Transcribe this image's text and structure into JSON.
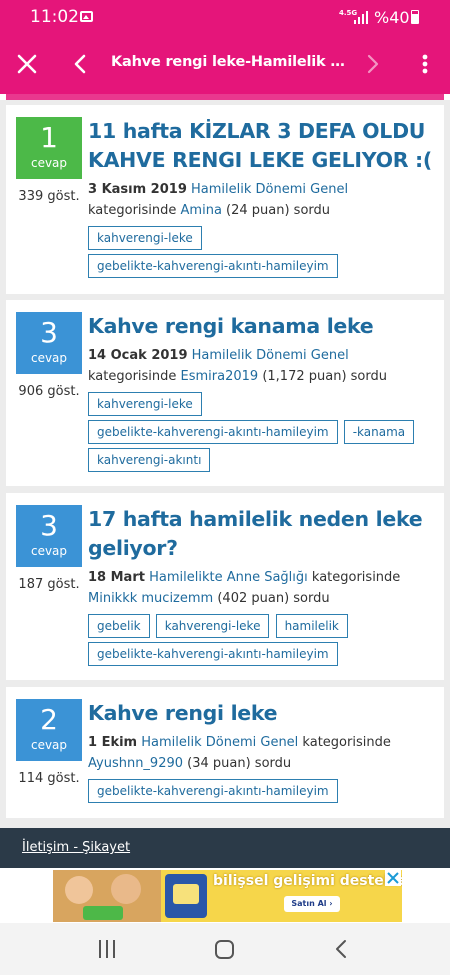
{
  "status": {
    "time": "11:02",
    "network": "4.5G",
    "battery": "%40"
  },
  "app_bar": {
    "title": "Kahve rengi leke-Hamilelik Dönem..."
  },
  "questions": [
    {
      "count": "1",
      "count_label": "cevap",
      "count_color": "#4cb948",
      "views": "339 göst.",
      "title": "11 hafta KİZLAR 3 DEFA OLDU KAHVE RENGI LEKE GELIYOR :(",
      "date": "3 Kasım 2019",
      "category": "Hamilelik Dönemi Genel",
      "mid_text": " kategorisinde ",
      "user": "Amina",
      "points": " (24 puan) sordu",
      "tags": [
        "kahverengi-leke",
        "gebelikte-kahverengi-akıntı-hamileyim"
      ]
    },
    {
      "count": "3",
      "count_label": "cevap",
      "count_color": "#3b93d6",
      "views": "906 göst.",
      "title": "Kahve rengi kanama leke",
      "date": "14 Ocak 2019",
      "category": "Hamilelik Dönemi Genel",
      "mid_text": " kategorisinde ",
      "user": "Esmira2019",
      "points": " (1,172 puan) sordu",
      "tags": [
        "kahverengi-leke",
        "gebelikte-kahverengi-akıntı-hamileyim",
        "-kanama",
        "kahverengi-akıntı"
      ]
    },
    {
      "count": "3",
      "count_label": "cevap",
      "count_color": "#3b93d6",
      "views": "187 göst.",
      "title": "17 hafta hamilelik neden leke geliyor?",
      "date": "18 Mart",
      "category": "Hamilelikte Anne Sağlığı",
      "mid_text": " kategorisinde ",
      "user": "Minikkk mucizemm",
      "points": " (402 puan) sordu",
      "tags": [
        "gebelik",
        "kahverengi-leke",
        "hamilelik",
        "gebelikte-kahverengi-akıntı-hamileyim"
      ]
    },
    {
      "count": "2",
      "count_label": "cevap",
      "count_color": "#3b93d6",
      "views": "114 göst.",
      "title": "Kahve rengi leke",
      "date": "1 Ekim",
      "category": "Hamilelik Dönemi Genel",
      "mid_text": " kategorisinde ",
      "user": "Ayushnn_9290",
      "points": " (34 puan) sordu",
      "tags": [
        "gebelikte-kahverengi-akıntı-hamileyim"
      ]
    }
  ],
  "footer": {
    "link": "İletişim - Şikayet"
  },
  "ad": {
    "headline": "bilişsel gelişimi destekler",
    "cta": "Satın Al ›"
  },
  "colors": {
    "brand": "#e5157a",
    "link": "#1f6b9e",
    "footer": "#2b3a48"
  }
}
